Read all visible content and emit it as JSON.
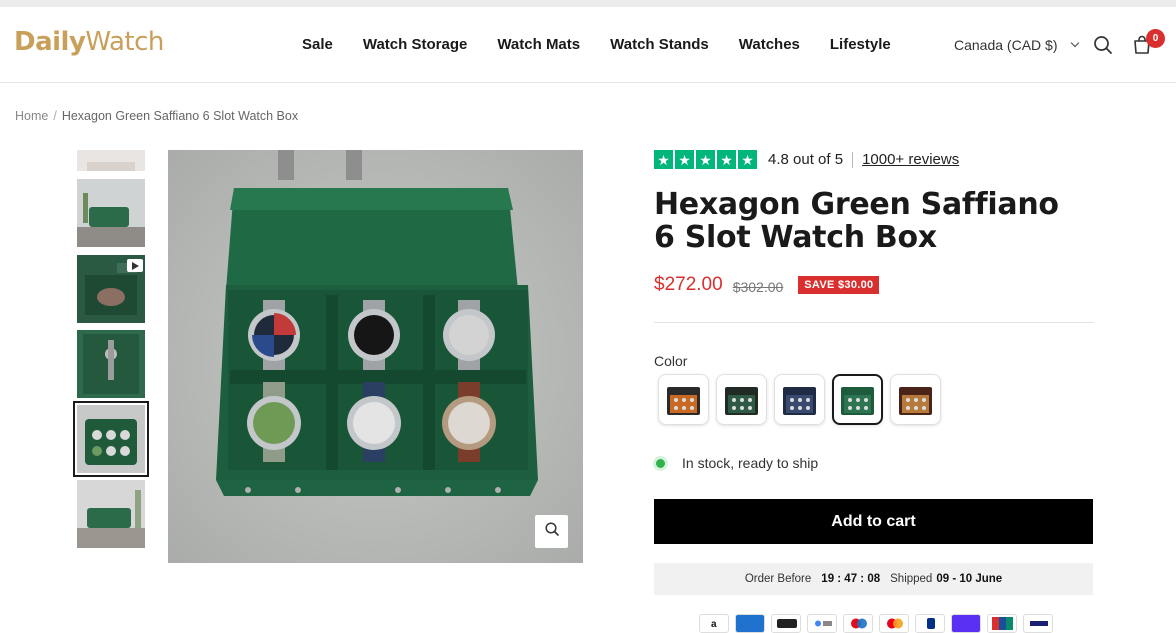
{
  "brand": {
    "logo_part1": "Daily",
    "logo_part2": "Watch",
    "color": "#c9a05a"
  },
  "nav": {
    "items": [
      "Sale",
      "Watch Storage",
      "Watch Mats",
      "Watch Stands",
      "Watches",
      "Lifestyle"
    ]
  },
  "header": {
    "currency": "Canada (CAD $)",
    "cart_count": "0",
    "icons": [
      "search-icon",
      "cart-icon",
      "chevron-down-icon"
    ]
  },
  "breadcrumb": {
    "home": "Home",
    "separator": "/",
    "current": "Hexagon Green Saffiano 6 Slot Watch Box"
  },
  "gallery": {
    "thumbnails": [
      "thumb-1",
      "thumb-2",
      "thumb-3-video",
      "thumb-4",
      "thumb-5-selected",
      "thumb-6"
    ],
    "selected_index": 4,
    "zoom_icon": "zoom-icon"
  },
  "product": {
    "rating_text": "4.8 out of 5",
    "rating_stars": 5,
    "reviews_link": "1000+ reviews",
    "title": "Hexagon Green Saffiano 6 Slot Watch Box",
    "price": "$272.00",
    "compare_price": "$302.00",
    "save_badge": "SAVE $30.00",
    "color_label": "Color",
    "swatches": [
      {
        "name": "black-orange",
        "base": "#2b2b2b",
        "accent": "#c96a24"
      },
      {
        "name": "black-green",
        "base": "#222a26",
        "accent": "#2f5b46"
      },
      {
        "name": "navy-blue",
        "base": "#1f2a44",
        "accent": "#3a4a6e"
      },
      {
        "name": "green",
        "base": "#1e5a3c",
        "accent": "#2d7550"
      },
      {
        "name": "brown-tan",
        "base": "#4a2418",
        "accent": "#b57a3c"
      }
    ],
    "selected_swatch": 3,
    "stock_text": "In stock, ready to ship",
    "add_to_cart": "Add to cart",
    "order_before_label": "Order Before",
    "countdown": "19 : 47 : 08",
    "shipped_label": "Shipped",
    "shipped_dates": "09 - 10 June"
  },
  "payments": [
    "amazon",
    "amex",
    "apple-pay",
    "google-pay",
    "maestro",
    "mastercard",
    "paypal",
    "shop-pay",
    "unionpay",
    "visa"
  ],
  "colors": {
    "sale_red": "#d9302f",
    "trustpilot_green": "#00b67a",
    "stock_green": "#2fb34a"
  }
}
